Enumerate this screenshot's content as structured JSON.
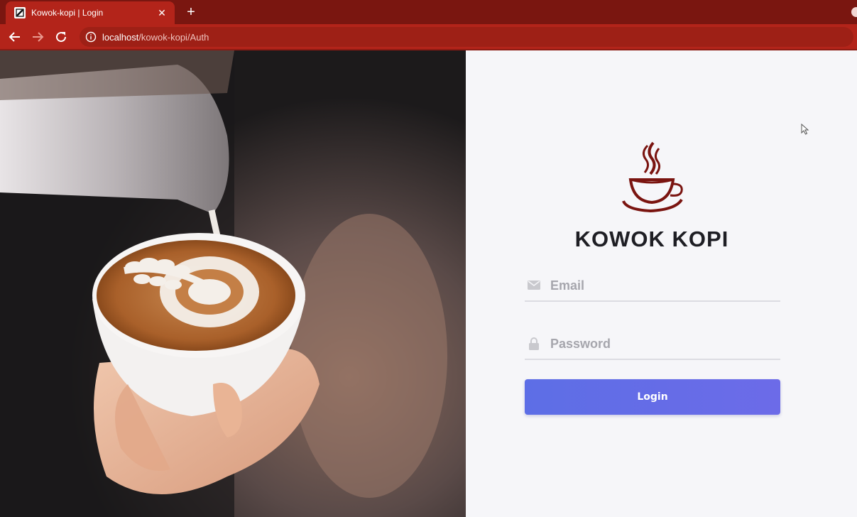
{
  "browser": {
    "tab": {
      "title": "Kowok-kopi | Login",
      "close": "✕"
    },
    "new_tab": "+",
    "address": {
      "host": "localhost",
      "path": "/kowok-kopi/Auth"
    }
  },
  "login": {
    "brand": "KOWOK KOPI",
    "email_placeholder": "Email",
    "password_placeholder": "Password",
    "submit_label": "Login"
  },
  "colors": {
    "chrome": "#b3241a",
    "tabbar": "#7a1610",
    "logo": "#7a1410",
    "button": "#6370e8"
  },
  "icons": {
    "email": "envelope-icon",
    "password": "lock-icon",
    "logo": "coffee-cup-icon"
  }
}
